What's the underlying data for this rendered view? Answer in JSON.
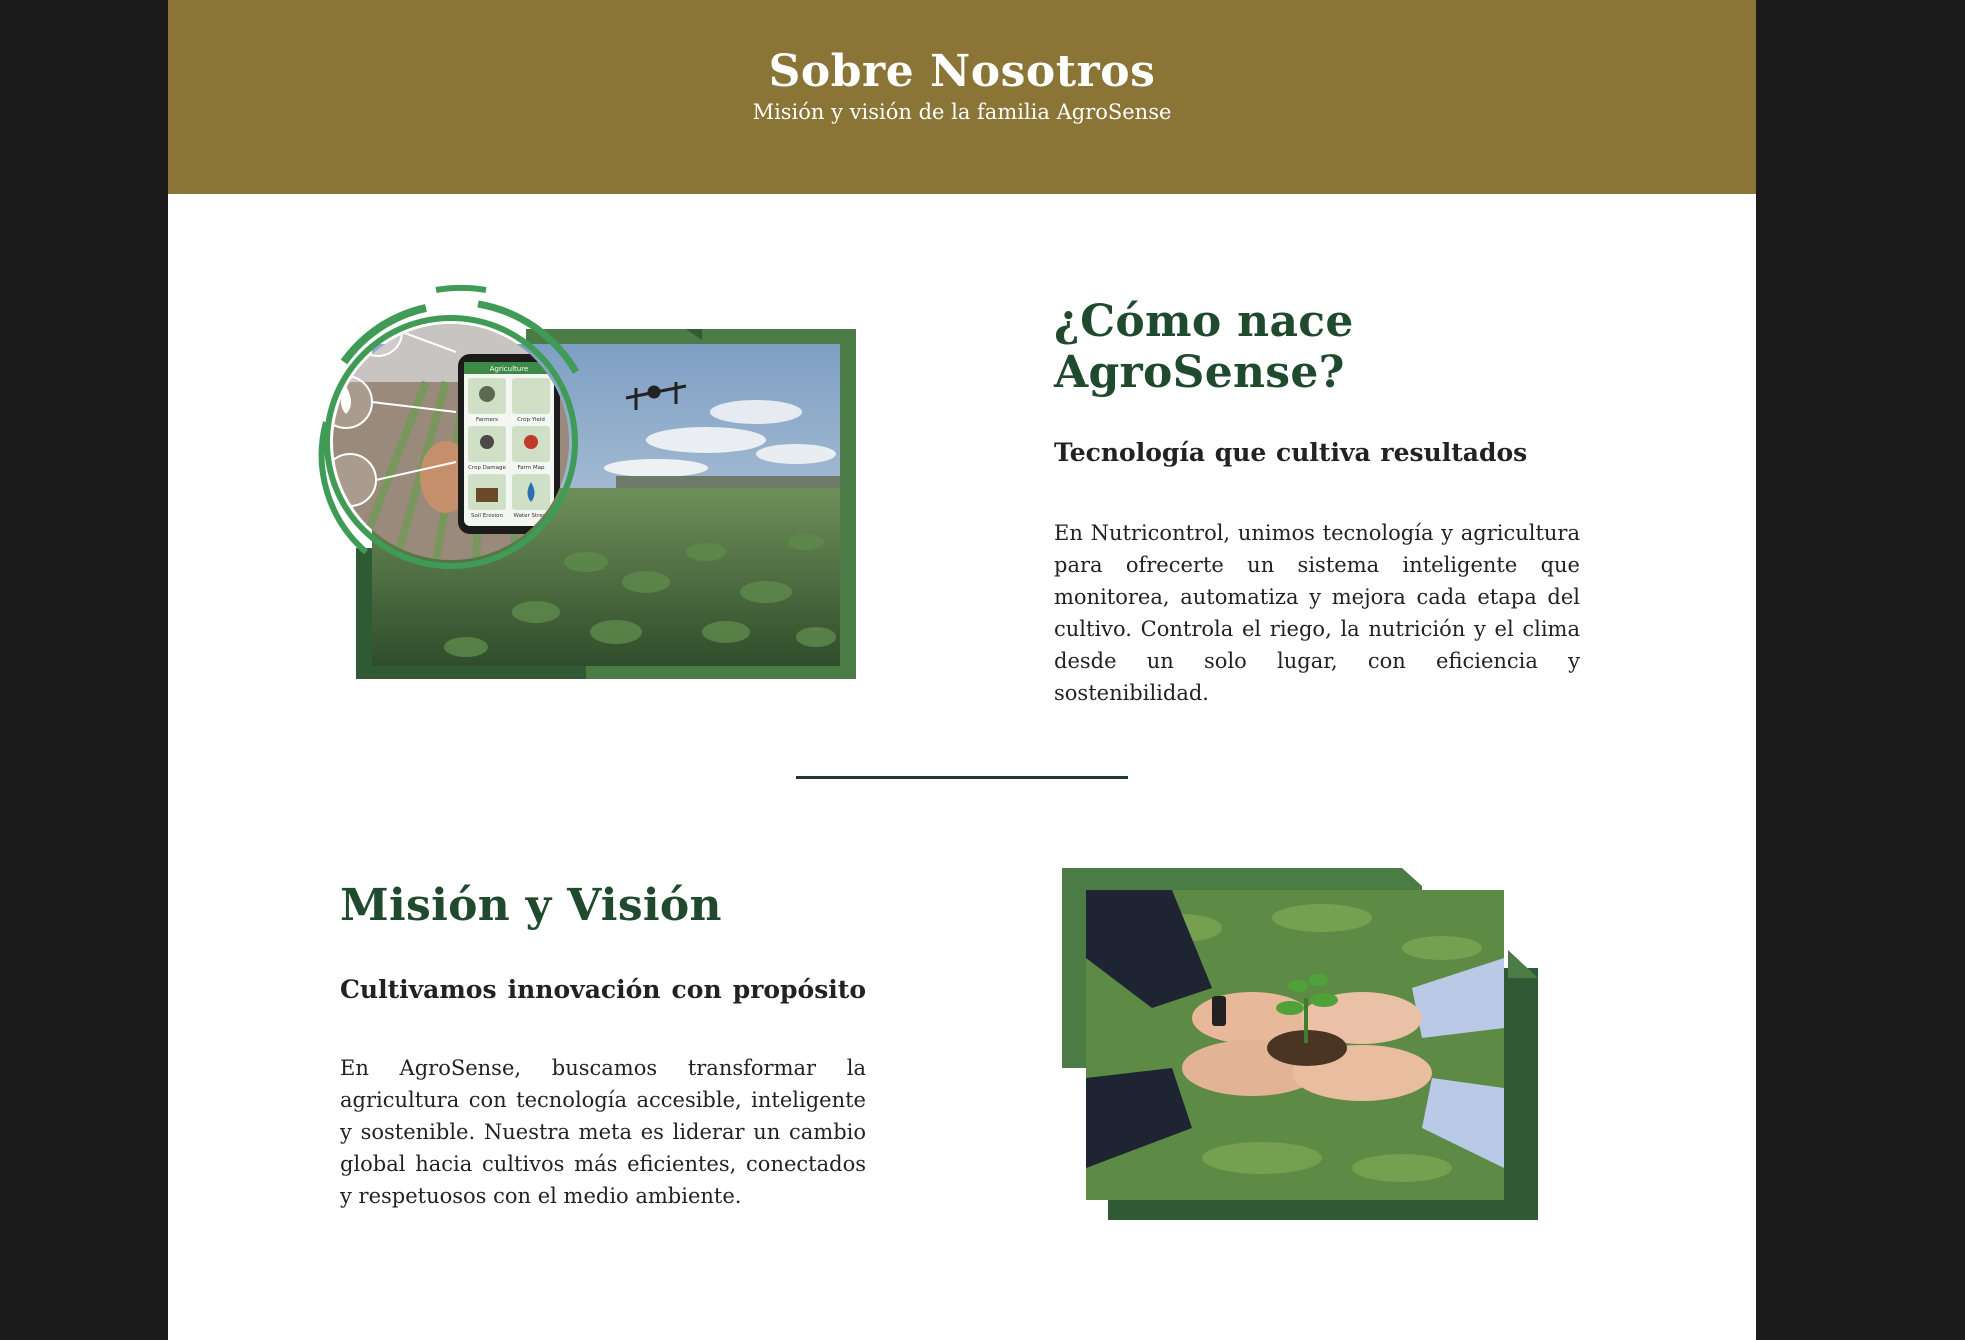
{
  "header": {
    "title": "Sobre Nosotros",
    "subtitle": "Misión y visión de la familia AgroSense"
  },
  "origin": {
    "title": "¿Cómo nace AgroSense?",
    "subtitle": "Tecnología que cultiva resultados",
    "body": "En Nutricontrol, unimos tecnología y agricultura para ofrecerte un sistema inteligente que monitorea, automatiza y mejora cada etapa del cultivo. Controla el riego, la nutrición y el clima desde un solo lugar, con eficiencia y sostenibilidad."
  },
  "mission": {
    "title": "Misión y Visión",
    "subtitle": "Cultivamos innovación con propósito",
    "body": "En AgroSense, buscamos transformar la agricultura con tecnología accesible, inteligente y sostenible. Nuestra meta es liderar un cambio global hacia cultivos más eficientes, conectados y respetuosos con el medio ambiente."
  },
  "app_screen": {
    "app_title": "Agriculture",
    "tiles": [
      "Farmers",
      "Crop Yield",
      "Crop Damage",
      "Farm Map",
      "Soil Erosion",
      "Water Stress"
    ]
  },
  "colors": {
    "header_bg": "#8b7536",
    "heading_green": "#1f4a2e",
    "frame_green": "#4b7c45",
    "frame_dark": "#2f5a33",
    "ring_green": "#3f9b55"
  }
}
